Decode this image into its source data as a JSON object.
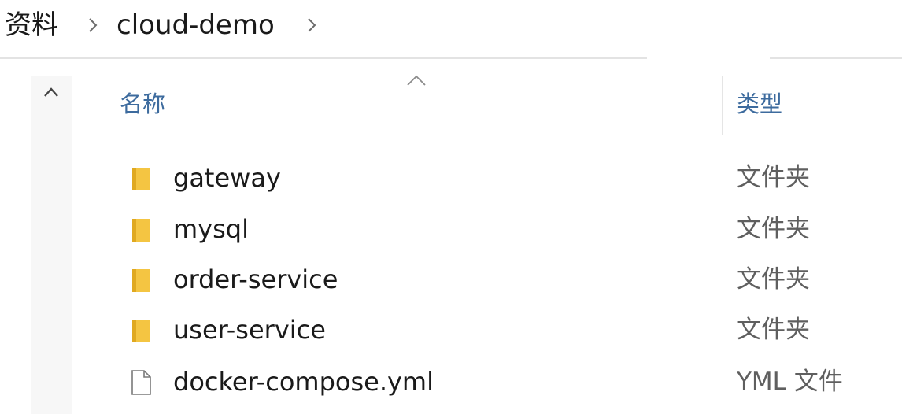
{
  "breadcrumb": {
    "items": [
      "资料",
      "cloud-demo"
    ],
    "separator_icon": "chevron-right-icon"
  },
  "columns": {
    "name": "名称",
    "type": "类型",
    "sort_icon": "sort-ascending-icon"
  },
  "navigation": {
    "up_icon": "chevron-up-icon"
  },
  "files": [
    {
      "name": "gateway",
      "type": "文件夹",
      "icon": "folder-icon"
    },
    {
      "name": "mysql",
      "type": "文件夹",
      "icon": "folder-icon"
    },
    {
      "name": "order-service",
      "type": "文件夹",
      "icon": "folder-icon"
    },
    {
      "name": "user-service",
      "type": "文件夹",
      "icon": "folder-icon"
    },
    {
      "name": "docker-compose.yml",
      "type": "YML 文件",
      "icon": "document-icon"
    }
  ],
  "colors": {
    "folder": "#f4c542",
    "header_text": "#3d6b9e",
    "secondary_text": "#5f5f5f"
  }
}
